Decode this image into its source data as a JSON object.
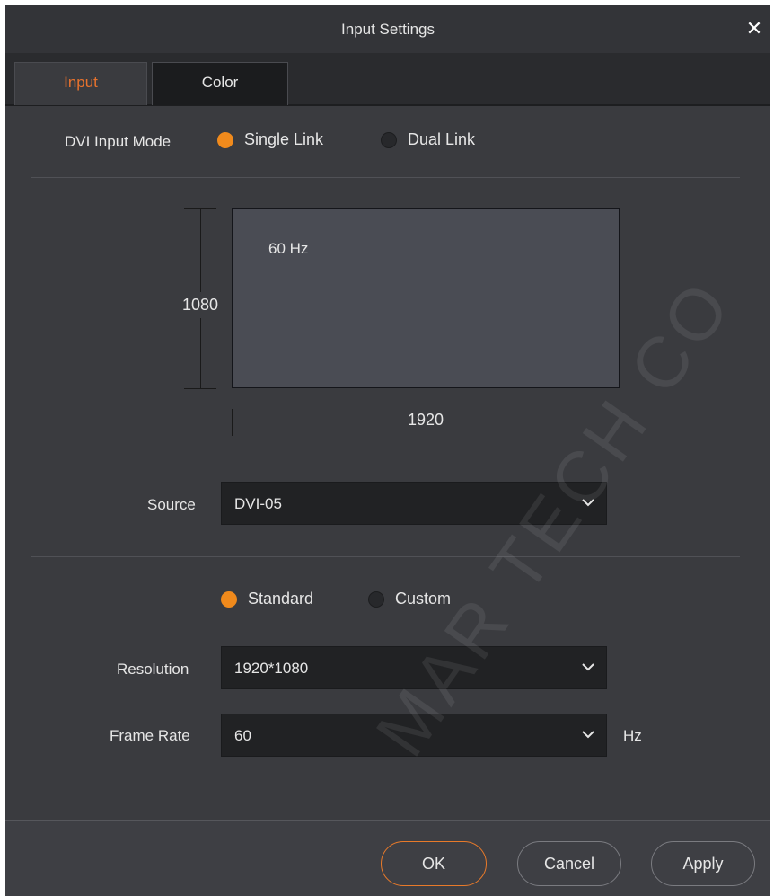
{
  "dialog": {
    "title": "Input Settings",
    "close_icon": "close-icon"
  },
  "tabs": [
    {
      "label": "Input",
      "active": true
    },
    {
      "label": "Color",
      "active": false
    }
  ],
  "dvi_mode": {
    "label": "DVI Input Mode",
    "options": [
      {
        "label": "Single Link",
        "selected": true
      },
      {
        "label": "Dual Link",
        "selected": false
      }
    ]
  },
  "preview": {
    "refresh": "60 Hz",
    "height_value": "1080",
    "width_value": "1920"
  },
  "source": {
    "label": "Source",
    "value": "DVI-05"
  },
  "mode": {
    "options": [
      {
        "label": "Standard",
        "selected": true
      },
      {
        "label": "Custom",
        "selected": false
      }
    ]
  },
  "resolution": {
    "label": "Resolution",
    "value": "1920*1080"
  },
  "frame_rate": {
    "label": "Frame Rate",
    "value": "60",
    "unit": "Hz"
  },
  "buttons": {
    "ok": "OK",
    "cancel": "Cancel",
    "apply": "Apply"
  },
  "watermark": "MAR TECH CO",
  "colors": {
    "accent": "#f08a1c",
    "background": "#3a3b3f"
  }
}
